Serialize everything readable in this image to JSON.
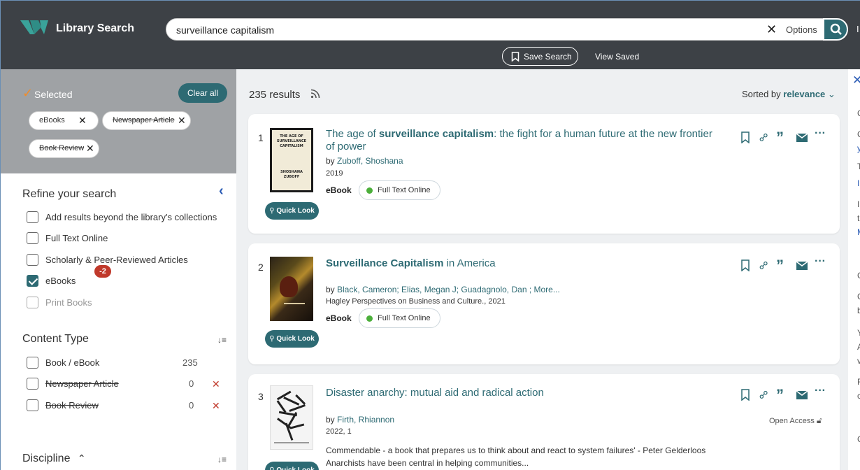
{
  "header": {
    "app_title": "Library Search",
    "search_value": "surveillance capitalism",
    "options_label": "Options",
    "save_search_label": "Save Search",
    "view_saved_label": "View Saved",
    "cutoff_char": "I"
  },
  "filters": {
    "selected_label": "Selected",
    "clear_all_label": "Clear all",
    "chips": [
      {
        "label": "eBooks",
        "struck": false
      },
      {
        "label": "Newspaper Article",
        "struck": true
      },
      {
        "label": "Book Review",
        "struck": true
      }
    ],
    "refine_title": "Refine your search",
    "options": [
      {
        "label": "Add results beyond the library's collections",
        "checked": false,
        "disabled": false
      },
      {
        "label": "Full Text Online",
        "checked": false,
        "disabled": false
      },
      {
        "label": "Scholarly & Peer-Reviewed Articles",
        "checked": false,
        "disabled": false
      },
      {
        "label": "eBooks",
        "checked": true,
        "disabled": false
      },
      {
        "label": "Print Books",
        "checked": false,
        "disabled": true
      }
    ],
    "content_type": {
      "title": "Content Type",
      "badge": "-2",
      "items": [
        {
          "label": "Book / eBook",
          "count": "235",
          "struck": false
        },
        {
          "label": "Newspaper Article",
          "count": "0",
          "struck": true
        },
        {
          "label": "Book Review",
          "count": "0",
          "struck": true
        }
      ]
    },
    "discipline_title": "Discipline"
  },
  "results": {
    "count_label": "235 results",
    "sorted_prefix": "Sorted by",
    "sorted_value": "relevance",
    "quicklook_label": "Quick Look",
    "items": [
      {
        "num": "1",
        "title_pre": "The age of ",
        "title_bold": "surveillance capitalism",
        "title_post": ": the fight for a human future at the new frontier of power",
        "author_prefix": "by ",
        "authors": "Zuboff, Shoshana",
        "meta": "2019",
        "format": "eBook",
        "availability": "Full Text Online",
        "cover_text": [
          "THE AGE OF",
          "SURVEILLANCE",
          "CAPITALISM",
          "SHOSHANA",
          "ZUBOFF"
        ]
      },
      {
        "num": "2",
        "title_pre": "",
        "title_bold": "Surveillance Capitalism",
        "title_post": " in America",
        "author_prefix": "by ",
        "authors": "Black, Cameron; Elias, Megan J; Guadagnolo, Dan ; More...",
        "meta": "Hagley Perspectives on Business and Culture., 2021",
        "format": "eBook",
        "availability": "Full Text Online"
      },
      {
        "num": "3",
        "title_pre": "Disaster anarchy: mutual aid and radical action",
        "title_bold": "",
        "title_post": "",
        "author_prefix": "by ",
        "authors": "Firth, Rhiannon",
        "meta": "2022, 1",
        "access": "Open Access",
        "snippet": "Commendable - a book that prepares us to think about and react to system failures' - Peter Gelderloos Anarchists have been central in helping communities..."
      }
    ]
  },
  "right_strip": [
    "C",
    "C",
    "y",
    "T",
    "I",
    "I",
    "t",
    "M",
    "C",
    "C",
    "b",
    "Y",
    "A",
    "v",
    "F",
    "c",
    "C"
  ],
  "colors": {
    "accent": "#2d6a73",
    "header_bg": "#3d4146",
    "badge_red": "#c0392b",
    "available_green": "#4caf3b",
    "check_orange": "#f28c28"
  }
}
